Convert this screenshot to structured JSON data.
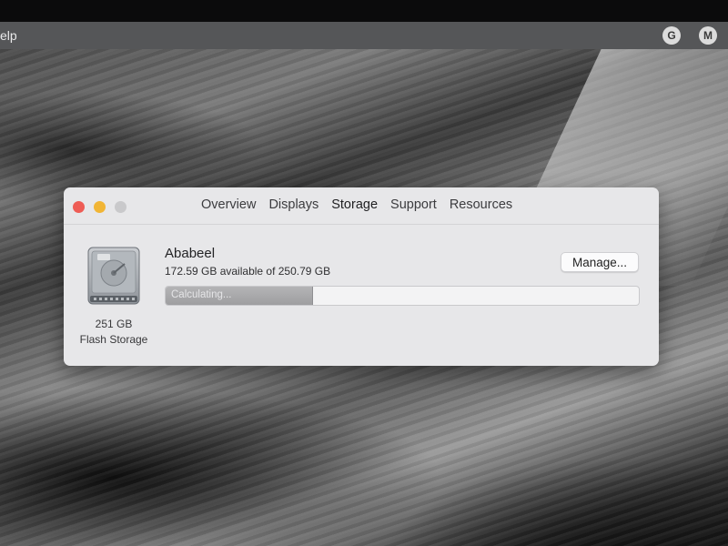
{
  "menubar": {
    "help_label": "elp",
    "icons": [
      {
        "name": "google-icon",
        "glyph": "G"
      },
      {
        "name": "m-icon",
        "glyph": "M"
      }
    ]
  },
  "window": {
    "tabs": [
      {
        "label": "Overview",
        "active": false
      },
      {
        "label": "Displays",
        "active": false
      },
      {
        "label": "Storage",
        "active": true
      },
      {
        "label": "Support",
        "active": false
      },
      {
        "label": "Resources",
        "active": false
      }
    ],
    "disk": {
      "icon": "hard-drive-icon",
      "size_label": "251 GB",
      "kind_label": "Flash Storage"
    },
    "volume": {
      "name": "Ababeel",
      "availability": "172.59 GB available of 250.79 GB"
    },
    "manage_button_label": "Manage...",
    "storage_bar": {
      "status_label": "Calculating...",
      "used_fraction": 0.31
    }
  },
  "colors": {
    "close": "#ee5c55",
    "minimize": "#f1b535",
    "zoom": "#c9c9cb"
  }
}
